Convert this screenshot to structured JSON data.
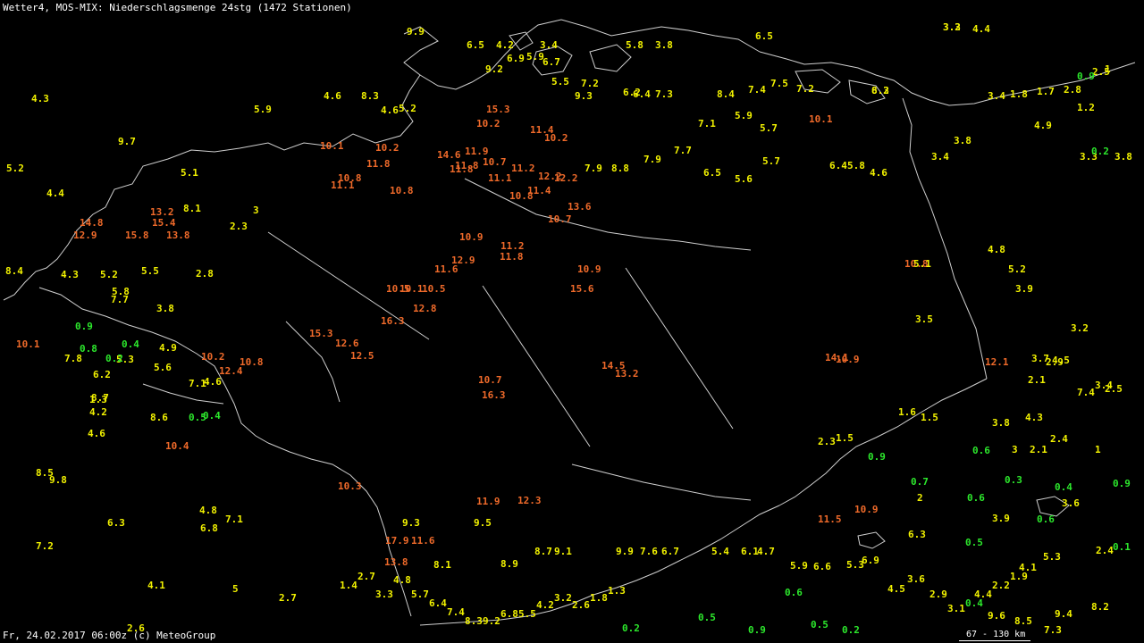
{
  "header": {
    "title": "Wetter4, MOS-MIX: Niederschlagsmenge 24stg (1472 Stationen)"
  },
  "footer": {
    "timestamp": "Fr, 24.02.2017 06:00z (c) MeteoGroup",
    "scale": "67 - 130 km"
  },
  "legend_colors": {
    "low": "#2ce82c",
    "mid": "#f2f200",
    "high": "#ef6a2a",
    "borders": "#cfcfcf",
    "background": "#000000"
  },
  "station_values": [
    {
      "v": "4.3",
      "c": "y"
    },
    {
      "v": "5.9",
      "c": "y"
    },
    {
      "v": "9.9",
      "c": "y"
    },
    {
      "v": "6.5",
      "c": "y"
    },
    {
      "v": "4.2",
      "c": "y"
    },
    {
      "v": "3.4",
      "c": "y"
    },
    {
      "v": "5.8",
      "c": "y"
    },
    {
      "v": "3.8",
      "c": "y"
    },
    {
      "v": "3.3",
      "c": "y"
    },
    {
      "v": "6.5",
      "c": "y"
    },
    {
      "v": "3.2",
      "c": "y"
    },
    {
      "v": "4.4",
      "c": "y"
    },
    {
      "v": "2.5",
      "c": "y"
    },
    {
      "v": "1",
      "c": "y"
    },
    {
      "v": "0.9",
      "c": "g"
    },
    {
      "v": "4.6",
      "c": "y"
    },
    {
      "v": "8.3",
      "c": "y"
    },
    {
      "v": "4.6",
      "c": "y"
    },
    {
      "v": "5.2",
      "c": "y"
    },
    {
      "v": "9.2",
      "c": "y"
    },
    {
      "v": "6.9",
      "c": "y"
    },
    {
      "v": "5.9",
      "c": "y"
    },
    {
      "v": "6.7",
      "c": "y"
    },
    {
      "v": "5.5",
      "c": "y"
    },
    {
      "v": "7.2",
      "c": "y"
    },
    {
      "v": "6.2",
      "c": "y"
    },
    {
      "v": "6.4",
      "c": "y"
    },
    {
      "v": "7.3",
      "c": "y"
    },
    {
      "v": "8.4",
      "c": "y"
    },
    {
      "v": "7.4",
      "c": "y"
    },
    {
      "v": "7.5",
      "c": "y"
    },
    {
      "v": "7.2",
      "c": "y"
    },
    {
      "v": "8.3",
      "c": "y"
    },
    {
      "v": "6.2",
      "c": "y"
    },
    {
      "v": "3.4",
      "c": "y"
    },
    {
      "v": "1.8",
      "c": "y"
    },
    {
      "v": "1.7",
      "c": "y"
    },
    {
      "v": "2.8",
      "c": "y"
    },
    {
      "v": "1.2",
      "c": "y"
    },
    {
      "v": "15.3",
      "c": "o"
    },
    {
      "v": "10.2",
      "c": "o"
    },
    {
      "v": "11.4",
      "c": "o"
    },
    {
      "v": "10.2",
      "c": "o"
    },
    {
      "v": "9.3",
      "c": "y"
    },
    {
      "v": "7.1",
      "c": "y"
    },
    {
      "v": "5.9",
      "c": "y"
    },
    {
      "v": "5.7",
      "c": "y"
    },
    {
      "v": "10.1",
      "c": "o"
    },
    {
      "v": "4.9",
      "c": "y"
    },
    {
      "v": "3.8",
      "c": "y"
    },
    {
      "v": "3.3",
      "c": "y"
    },
    {
      "v": "0.2",
      "c": "g"
    },
    {
      "v": "3.8",
      "c": "y"
    },
    {
      "v": "10.1",
      "c": "o"
    },
    {
      "v": "10.2",
      "c": "o"
    },
    {
      "v": "11.8",
      "c": "o"
    },
    {
      "v": "14.6",
      "c": "o"
    },
    {
      "v": "11.9",
      "c": "o"
    },
    {
      "v": "11.8",
      "c": "o"
    },
    {
      "v": "10.7",
      "c": "o"
    },
    {
      "v": "11.2",
      "c": "o"
    },
    {
      "v": "12.2",
      "c": "o"
    },
    {
      "v": "7.9",
      "c": "y"
    },
    {
      "v": "8.8",
      "c": "y"
    },
    {
      "v": "7.9",
      "c": "y"
    },
    {
      "v": "7.7",
      "c": "y"
    },
    {
      "v": "6.5",
      "c": "y"
    },
    {
      "v": "5.6",
      "c": "y"
    },
    {
      "v": "5.7",
      "c": "y"
    },
    {
      "v": "6.4",
      "c": "y"
    },
    {
      "v": "5.8",
      "c": "y"
    },
    {
      "v": "4.6",
      "c": "y"
    },
    {
      "v": "3.4",
      "c": "y"
    },
    {
      "v": "14.8",
      "c": "o"
    },
    {
      "v": "13.2",
      "c": "o"
    },
    {
      "v": "15.4",
      "c": "o"
    },
    {
      "v": "12.9",
      "c": "o"
    },
    {
      "v": "15.8",
      "c": "o"
    },
    {
      "v": "13.8",
      "c": "o"
    },
    {
      "v": "10.8",
      "c": "o"
    },
    {
      "v": "10.8",
      "c": "o"
    },
    {
      "v": "11.1",
      "c": "o"
    },
    {
      "v": "13.6",
      "c": "o"
    },
    {
      "v": "10.7",
      "c": "o"
    },
    {
      "v": "10.8",
      "c": "o"
    },
    {
      "v": "11.4",
      "c": "o"
    },
    {
      "v": "11.8",
      "c": "o"
    },
    {
      "v": "11.1",
      "c": "o"
    },
    {
      "v": "10.9",
      "c": "o"
    },
    {
      "v": "12.9",
      "c": "o"
    },
    {
      "v": "11.2",
      "c": "o"
    },
    {
      "v": "11.8",
      "c": "o"
    },
    {
      "v": "10.5",
      "c": "o"
    },
    {
      "v": "10.1",
      "c": "o"
    },
    {
      "v": "10.9",
      "c": "o"
    },
    {
      "v": "15.6",
      "c": "o"
    },
    {
      "v": "12.2",
      "c": "o"
    },
    {
      "v": "11.6",
      "c": "o"
    },
    {
      "v": "10.5",
      "c": "o"
    },
    {
      "v": "12.8",
      "c": "o"
    },
    {
      "v": "16.3",
      "c": "o"
    },
    {
      "v": "15.3",
      "c": "o"
    },
    {
      "v": "12.6",
      "c": "o"
    },
    {
      "v": "12.5",
      "c": "o"
    },
    {
      "v": "10.2",
      "c": "o"
    },
    {
      "v": "12.4",
      "c": "o"
    },
    {
      "v": "10.8",
      "c": "o"
    },
    {
      "v": "14.5",
      "c": "o"
    },
    {
      "v": "13.2",
      "c": "o"
    },
    {
      "v": "10.7",
      "c": "o"
    },
    {
      "v": "16.3",
      "c": "o"
    },
    {
      "v": "10.4",
      "c": "o"
    },
    {
      "v": "10.3",
      "c": "o"
    },
    {
      "v": "12.3",
      "c": "o"
    },
    {
      "v": "11.6",
      "c": "o"
    },
    {
      "v": "17.9",
      "c": "o"
    },
    {
      "v": "13.8",
      "c": "o"
    },
    {
      "v": "11.9",
      "c": "o"
    },
    {
      "v": "11.5",
      "c": "o"
    },
    {
      "v": "10.9",
      "c": "o"
    },
    {
      "v": "14.1",
      "c": "o"
    },
    {
      "v": "10.9",
      "c": "o"
    },
    {
      "v": "12.1",
      "c": "o"
    },
    {
      "v": "10.1",
      "c": "o"
    },
    {
      "v": "10.8",
      "c": "o"
    },
    {
      "v": "5.1",
      "c": "y"
    },
    {
      "v": "5.2",
      "c": "y"
    },
    {
      "v": "4.8",
      "c": "y"
    },
    {
      "v": "3.9",
      "c": "y"
    },
    {
      "v": "3.5",
      "c": "y"
    },
    {
      "v": "3.7",
      "c": "y"
    },
    {
      "v": "4.5",
      "c": "y"
    },
    {
      "v": "3.2",
      "c": "y"
    },
    {
      "v": "2.9",
      "c": "y"
    },
    {
      "v": "2.1",
      "c": "y"
    },
    {
      "v": "3.4",
      "c": "y"
    },
    {
      "v": "7.4",
      "c": "y"
    },
    {
      "v": "2.5",
      "c": "y"
    },
    {
      "v": "1.6",
      "c": "y"
    },
    {
      "v": "1.5",
      "c": "y"
    },
    {
      "v": "3.8",
      "c": "y"
    },
    {
      "v": "4.3",
      "c": "y"
    },
    {
      "v": "2.4",
      "c": "y"
    },
    {
      "v": "2.1",
      "c": "y"
    },
    {
      "v": "1",
      "c": "y"
    },
    {
      "v": "0.6",
      "c": "g"
    },
    {
      "v": "3",
      "c": "y"
    },
    {
      "v": "2.3",
      "c": "y"
    },
    {
      "v": "1.5",
      "c": "y"
    },
    {
      "v": "0.9",
      "c": "g"
    },
    {
      "v": "0.3",
      "c": "g"
    },
    {
      "v": "0.7",
      "c": "g"
    },
    {
      "v": "2",
      "c": "y"
    },
    {
      "v": "0.6",
      "c": "g"
    },
    {
      "v": "0.4",
      "c": "g"
    },
    {
      "v": "0.9",
      "c": "g"
    },
    {
      "v": "3.6",
      "c": "y"
    },
    {
      "v": "3.9",
      "c": "y"
    },
    {
      "v": "0.6",
      "c": "g"
    },
    {
      "v": "6.3",
      "c": "y"
    },
    {
      "v": "0.5",
      "c": "g"
    },
    {
      "v": "0.1",
      "c": "g"
    },
    {
      "v": "2.4",
      "c": "y"
    },
    {
      "v": "5.3",
      "c": "y"
    },
    {
      "v": "4.1",
      "c": "y"
    },
    {
      "v": "4.8",
      "c": "y"
    },
    {
      "v": "6.3",
      "c": "y"
    },
    {
      "v": "7.2",
      "c": "y"
    },
    {
      "v": "6.8",
      "c": "y"
    },
    {
      "v": "4.1",
      "c": "y"
    },
    {
      "v": "5",
      "c": "y"
    },
    {
      "v": "2.7",
      "c": "y"
    },
    {
      "v": "2.6",
      "c": "y"
    },
    {
      "v": "7.1",
      "c": "y"
    },
    {
      "v": "8.5",
      "c": "y"
    },
    {
      "v": "9.8",
      "c": "y"
    },
    {
      "v": "4.6",
      "c": "y"
    },
    {
      "v": "8.6",
      "c": "y"
    },
    {
      "v": "4.2",
      "c": "y"
    },
    {
      "v": "1.3",
      "c": "y"
    },
    {
      "v": "8.7",
      "c": "y"
    },
    {
      "v": "4.6",
      "c": "y"
    },
    {
      "v": "7.8",
      "c": "y"
    },
    {
      "v": "6.2",
      "c": "y"
    },
    {
      "v": "5.3",
      "c": "y"
    },
    {
      "v": "4.9",
      "c": "y"
    },
    {
      "v": "5.6",
      "c": "y"
    },
    {
      "v": "7.1",
      "c": "y"
    },
    {
      "v": "5.8",
      "c": "y"
    },
    {
      "v": "3.8",
      "c": "y"
    },
    {
      "v": "2.8",
      "c": "y"
    },
    {
      "v": "5.5",
      "c": "y"
    },
    {
      "v": "2.3",
      "c": "y"
    },
    {
      "v": "3",
      "c": "y"
    },
    {
      "v": "8.1",
      "c": "y"
    },
    {
      "v": "9.7",
      "c": "y"
    },
    {
      "v": "5.1",
      "c": "y"
    },
    {
      "v": "5.2",
      "c": "y"
    },
    {
      "v": "4.4",
      "c": "y"
    },
    {
      "v": "8.4",
      "c": "y"
    },
    {
      "v": "4.3",
      "c": "y"
    },
    {
      "v": "5.2",
      "c": "y"
    },
    {
      "v": "7.7",
      "c": "y"
    },
    {
      "v": "0.9",
      "c": "g"
    },
    {
      "v": "0.4",
      "c": "g"
    },
    {
      "v": "0.8",
      "c": "g"
    },
    {
      "v": "0.2",
      "c": "g"
    },
    {
      "v": "0.5",
      "c": "g"
    },
    {
      "v": "0.4",
      "c": "g"
    },
    {
      "v": "0.2",
      "c": "g"
    },
    {
      "v": "0.5",
      "c": "g"
    },
    {
      "v": "0.6",
      "c": "g"
    },
    {
      "v": "0.9",
      "c": "g"
    },
    {
      "v": "0.5",
      "c": "g"
    },
    {
      "v": "0.2",
      "c": "g"
    },
    {
      "v": "0.4",
      "c": "g"
    },
    {
      "v": "9.6",
      "c": "y"
    },
    {
      "v": "8.5",
      "c": "y"
    },
    {
      "v": "7.3",
      "c": "y"
    },
    {
      "v": "9.4",
      "c": "y"
    },
    {
      "v": "8.2",
      "c": "y"
    },
    {
      "v": "9.5",
      "c": "y"
    },
    {
      "v": "9.3",
      "c": "y"
    },
    {
      "v": "8.1",
      "c": "y"
    },
    {
      "v": "8.9",
      "c": "y"
    },
    {
      "v": "8.7",
      "c": "y"
    },
    {
      "v": "9.1",
      "c": "y"
    },
    {
      "v": "9.9",
      "c": "y"
    },
    {
      "v": "7.6",
      "c": "y"
    },
    {
      "v": "6.7",
      "c": "y"
    },
    {
      "v": "5.4",
      "c": "y"
    },
    {
      "v": "6.1",
      "c": "y"
    },
    {
      "v": "4.7",
      "c": "y"
    },
    {
      "v": "5.9",
      "c": "y"
    },
    {
      "v": "6.6",
      "c": "y"
    },
    {
      "v": "5.3",
      "c": "y"
    },
    {
      "v": "6.9",
      "c": "y"
    },
    {
      "v": "4.5",
      "c": "y"
    },
    {
      "v": "3.6",
      "c": "y"
    },
    {
      "v": "2.9",
      "c": "y"
    },
    {
      "v": "3.1",
      "c": "y"
    },
    {
      "v": "4.4",
      "c": "y"
    },
    {
      "v": "2.2",
      "c": "y"
    },
    {
      "v": "1.9",
      "c": "y"
    },
    {
      "v": "1.4",
      "c": "y"
    },
    {
      "v": "2.7",
      "c": "y"
    },
    {
      "v": "3.3",
      "c": "y"
    },
    {
      "v": "4.8",
      "c": "y"
    },
    {
      "v": "5.7",
      "c": "y"
    },
    {
      "v": "6.4",
      "c": "y"
    },
    {
      "v": "7.4",
      "c": "y"
    },
    {
      "v": "8.3",
      "c": "y"
    },
    {
      "v": "9.2",
      "c": "y"
    },
    {
      "v": "6.8",
      "c": "y"
    },
    {
      "v": "5.5",
      "c": "y"
    },
    {
      "v": "4.2",
      "c": "y"
    },
    {
      "v": "3.2",
      "c": "y"
    },
    {
      "v": "2.6",
      "c": "y"
    },
    {
      "v": "1.8",
      "c": "y"
    },
    {
      "v": "1.3",
      "c": "y"
    }
  ]
}
